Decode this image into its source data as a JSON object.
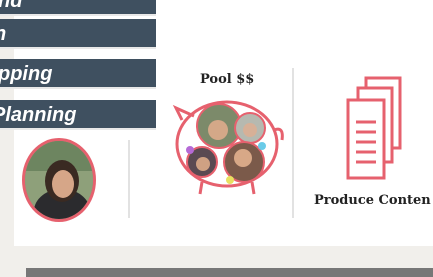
{
  "menu": {
    "items": [
      {
        "label": "nd"
      },
      {
        "label": "n"
      },
      {
        "label": "pping"
      },
      {
        "label": " Planning"
      }
    ]
  },
  "pool_card": {
    "title": "Pool $$"
  },
  "content_card": {
    "label": "Produce Conten"
  },
  "colors": {
    "menu_bg": "#3f5060",
    "accent_red": "#e6616e",
    "footer_bar": "#777777"
  }
}
